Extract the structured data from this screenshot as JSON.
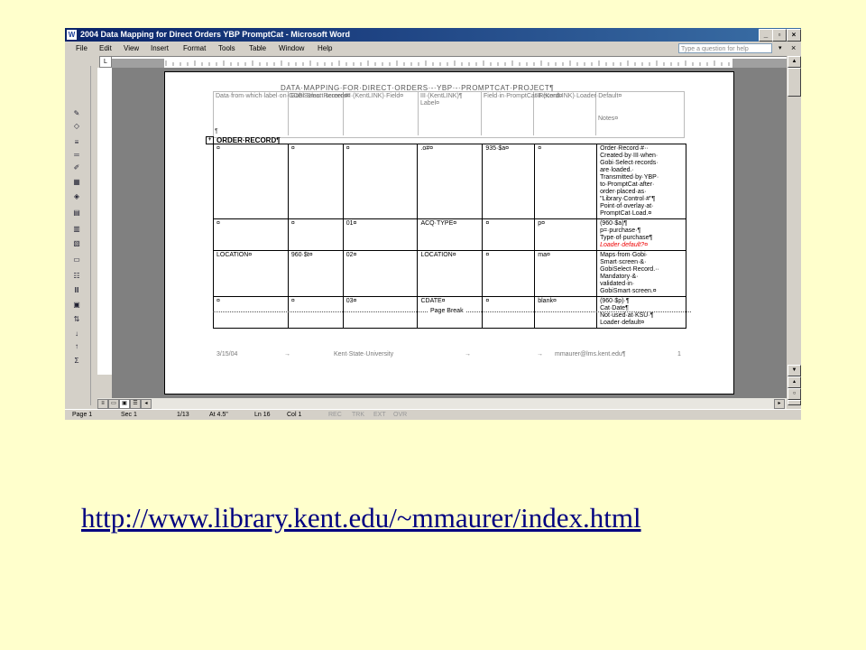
{
  "window": {
    "title": "2004 Data Mapping for Direct Orders YBP PromptCat - Microsoft Word",
    "app_icon": "word-icon",
    "buttons": [
      "minimize-icon",
      "restore-icon",
      "close-icon"
    ]
  },
  "menu": {
    "items": [
      "File",
      "Edit",
      "View",
      "Insert",
      "Format",
      "Tools",
      "Table",
      "Window",
      "Help"
    ],
    "question_placeholder": "Type a question for help",
    "close_glyph": "×",
    "arrow_glyph": "▾"
  },
  "ruler": {
    "corner": "L"
  },
  "toolbar_icons": [
    "pen-icon",
    "eraser-icon",
    "line-style-icon",
    "line-weight-icon",
    "pen-color-icon",
    "borders-icon",
    "shading-icon",
    "table-icon",
    "merge-icon",
    "split-icon",
    "align-icon",
    "distribute-rows-icon",
    "distribute-cols-icon",
    "autoformat-icon",
    "text-direction-icon",
    "sort-ascending-icon",
    "sort-descending-icon",
    "sum-icon"
  ],
  "document": {
    "heading": "DATA·MAPPING·FOR·DIRECT·ORDERS·-·YBP·-·PROMPTCAT·PROJECT¶",
    "header_cells": [
      "Data·from·which·label·on·GOBI·Smart·screen¤",
      "GobiSelect·Records¤",
      "III·(KentLINK)·Field¤",
      "III·(KentLINK)¶ Label¤",
      "Field·in·PromptCat·Record¤",
      "III·(KentLINK)·Loader·Default¤",
      "Notes¤"
    ],
    "pilcrow": "¶",
    "order_record_label": "ORDER·RECORD¶",
    "rows": [
      {
        "cells": [
          "¤",
          "¤",
          "¤",
          ".o#¤",
          "935·$a¤",
          "¤"
        ],
        "notes": [
          "Order·Record·#··",
          "Created·by·III·when·",
          "Gobi·Select·records·",
          "are·loaded.·",
          "Transmitted·by·YBP·",
          "to·PromptCat·after·",
          "order·placed·as·",
          "\"Library·Control·#\"¶",
          "Point·of·overlay·at·",
          "PromptCat·Load.¤"
        ],
        "note_red": ""
      },
      {
        "cells": [
          "¤",
          "¤",
          "01¤",
          "ACQ·TYPE¤",
          "¤",
          "p¤"
        ],
        "notes": [
          "(960·$a)¶",
          "p=·purchase·¶",
          "Type·of·purchase¶"
        ],
        "note_red": "Loader·default?¤"
      },
      {
        "cells": [
          "LOCATION¤",
          "960·$t¤",
          "02¤",
          "LOCATION¤",
          "¤",
          "ma¤"
        ],
        "notes": [
          "Maps·from·Gobi·",
          "Smart·screen·&·",
          "GobiSelect·Record.··",
          "Mandatory·&·",
          "validated·in·",
          "GobiSmart·screen.¤"
        ],
        "note_red": ""
      },
      {
        "cells": [
          "¤",
          "¤",
          "03¤",
          "CDATE¤",
          "¤",
          "blank¤"
        ],
        "notes": [
          "(960·$p)·¶",
          "Cat·Date¶",
          "Not·used·at·KSU·¶",
          "Loader·default¤"
        ],
        "note_red": ""
      }
    ],
    "page_break": "Page Break",
    "footer": {
      "date": "3/15/04",
      "arrow1": "→",
      "org": "Kent·State·University",
      "arrow2": "→",
      "arrow3": "→",
      "email": "mmaurer@lms.kent.edu¶",
      "page_num": "1"
    }
  },
  "status": {
    "page": "Page 1",
    "sec": "Sec 1",
    "pages": "1/13",
    "at": "At 4.5\"",
    "ln": "Ln 16",
    "col": "Col 1",
    "modes": [
      "REC",
      "TRK",
      "EXT",
      "OVR"
    ]
  },
  "url": "http://www.library.kent.edu/~mmaurer/index.html"
}
